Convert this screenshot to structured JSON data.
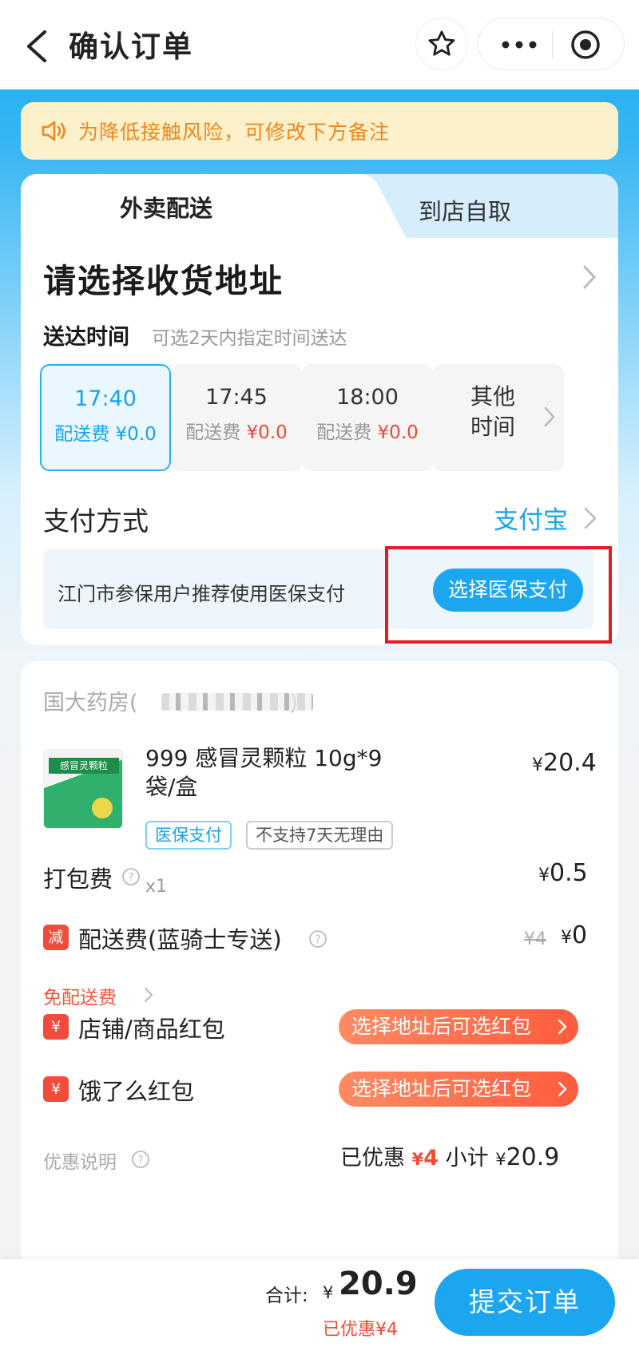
{
  "header": {
    "title": "确认订单"
  },
  "notice": {
    "text": "为降低接触风险，可修改下方备注"
  },
  "tabs": {
    "active": "外卖配送",
    "inactive": "到店自取"
  },
  "address": {
    "title": "请选择收货地址"
  },
  "delivery": {
    "label": "送达时间",
    "hint": "可选2天内指定时间送达",
    "fee_prefix": "配送费",
    "slots": [
      {
        "time": "17:40",
        "fee": "¥0.0",
        "selected": true
      },
      {
        "time": "17:45",
        "fee": "¥0.0",
        "selected": false
      },
      {
        "time": "18:00",
        "fee": "¥0.0",
        "selected": false
      }
    ],
    "other_line1": "其他",
    "other_line2": "时间"
  },
  "payment": {
    "label": "支付方式",
    "value": "支付宝",
    "insurance_hint": "江门市参保用户推荐使用医保支付",
    "insurance_button": "选择医保支付"
  },
  "order": {
    "store": "国大药房(",
    "store_suffix": ")",
    "product": {
      "name": "999 感冒灵颗粒 10g*9袋/盒",
      "image_label": "感冒灵颗粒",
      "price_cur": "¥",
      "price": "20.4",
      "tags": [
        "医保支付",
        "不支持7天无理由"
      ],
      "qty": "x1"
    },
    "packing": {
      "label": "打包费",
      "cur": "¥",
      "value": "0.5"
    },
    "shipping": {
      "badge": "减",
      "label": "配送费(蓝骑士专送)",
      "original": "¥4",
      "cur": "¥",
      "value": "0",
      "free_label": "免配送费"
    },
    "store_coupon": {
      "badge": "¥",
      "label": "店铺/商品红包",
      "action": "选择地址后可选红包"
    },
    "eleme_coupon": {
      "badge": "¥",
      "label": "饿了么红包",
      "action": "选择地址后可选红包"
    },
    "discount": {
      "label": "优惠说明",
      "saved_label": "已优惠",
      "saved_cur": "¥",
      "saved_value": "4",
      "subtotal_label": "小计",
      "subtotal_cur": "¥",
      "subtotal_value": "20.9"
    }
  },
  "bottom": {
    "total_label": "合计:",
    "cur": "¥",
    "amount": "20.9",
    "saved": "已优惠¥4",
    "submit": "提交订单"
  },
  "colors": {
    "primary": "#1ba6ef",
    "accent_red": "#ef4d37",
    "notice_bg": "#fdf1cc",
    "notice_text": "#f0861a",
    "highlight_border": "#e21b24"
  }
}
